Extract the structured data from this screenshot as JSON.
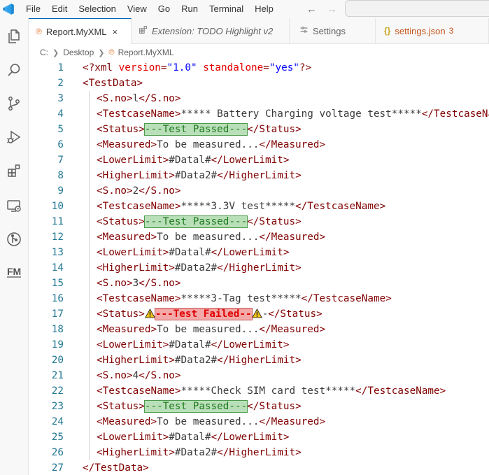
{
  "menu": {
    "items": [
      "File",
      "Edit",
      "Selection",
      "View",
      "Go",
      "Run",
      "Terminal",
      "Help"
    ]
  },
  "tabs": [
    {
      "label": "Report.MyXML",
      "icon": "rss-file-icon",
      "active": true,
      "has_close": true,
      "close_glyph": "×"
    },
    {
      "label": "Extension: TODO Highlight v2",
      "icon": "extension-preview-icon",
      "active": false,
      "italic": true
    },
    {
      "label": "Settings",
      "icon": "settings-sliders-icon",
      "active": false
    },
    {
      "label": "settings.json",
      "icon": "json-braces-icon",
      "active": false,
      "modified": true,
      "problem_count": "3"
    }
  ],
  "breadcrumb": {
    "items": [
      "C:",
      "Desktop",
      "Report.MyXML"
    ]
  },
  "editor": {
    "lines": [
      {
        "n": "1",
        "indent": 0,
        "parts": [
          [
            "tag",
            "<?xml "
          ],
          [
            "attr",
            "version"
          ],
          [
            "tag",
            "="
          ],
          [
            "val",
            "\"1.0\""
          ],
          [
            "tag",
            " "
          ],
          [
            "attr",
            "standalone"
          ],
          [
            "tag",
            "="
          ],
          [
            "val",
            "\"yes\""
          ],
          [
            "tag",
            "?>"
          ]
        ]
      },
      {
        "n": "2",
        "indent": 0,
        "parts": [
          [
            "tag",
            "<TestData>"
          ]
        ]
      },
      {
        "n": "3",
        "indent": 1,
        "parts": [
          [
            "tag",
            "<S.no>"
          ],
          [
            "txt",
            "l"
          ],
          [
            "tag",
            "</S.no>"
          ]
        ]
      },
      {
        "n": "4",
        "indent": 1,
        "parts": [
          [
            "tag",
            "<TestcaseName>"
          ],
          [
            "txt",
            "***** Battery Charging voltage test*****"
          ],
          [
            "tag",
            "</TestcaseName>"
          ]
        ]
      },
      {
        "n": "5",
        "indent": 1,
        "parts": [
          [
            "tag",
            "<Status>"
          ],
          [
            "pass",
            "---Test Passed---"
          ],
          [
            "tag",
            "</Status>"
          ]
        ]
      },
      {
        "n": "6",
        "indent": 1,
        "parts": [
          [
            "tag",
            "<Measured>"
          ],
          [
            "txt",
            "To be measured..."
          ],
          [
            "tag",
            "</Measured>"
          ]
        ]
      },
      {
        "n": "7",
        "indent": 1,
        "parts": [
          [
            "tag",
            "<LowerLimit>"
          ],
          [
            "txt",
            "#Datal#"
          ],
          [
            "tag",
            "</LowerLimit>"
          ]
        ]
      },
      {
        "n": "8",
        "indent": 1,
        "parts": [
          [
            "tag",
            "<HigherLimit>"
          ],
          [
            "txt",
            "#Data2#"
          ],
          [
            "tag",
            "</HigherLimit>"
          ]
        ]
      },
      {
        "n": "9",
        "indent": 1,
        "parts": [
          [
            "tag",
            "<S.no>"
          ],
          [
            "txt",
            "2"
          ],
          [
            "tag",
            "</S.no>"
          ]
        ]
      },
      {
        "n": "10",
        "indent": 1,
        "parts": [
          [
            "tag",
            "<TestcaseName>"
          ],
          [
            "txt",
            "*****3.3V test*****"
          ],
          [
            "tag",
            "</TestcaseName>"
          ]
        ]
      },
      {
        "n": "11",
        "indent": 1,
        "parts": [
          [
            "tag",
            "<Status>"
          ],
          [
            "pass",
            "---Test Passed---"
          ],
          [
            "tag",
            "</Status>"
          ]
        ]
      },
      {
        "n": "12",
        "indent": 1,
        "parts": [
          [
            "tag",
            "<Measured>"
          ],
          [
            "txt",
            "To be measured..."
          ],
          [
            "tag",
            "</Measured>"
          ]
        ]
      },
      {
        "n": "13",
        "indent": 1,
        "parts": [
          [
            "tag",
            "<LowerLimit>"
          ],
          [
            "txt",
            "#Datal#"
          ],
          [
            "tag",
            "</LowerLimit>"
          ]
        ]
      },
      {
        "n": "14",
        "indent": 1,
        "parts": [
          [
            "tag",
            "<HigherLimit>"
          ],
          [
            "txt",
            "#Data2#"
          ],
          [
            "tag",
            "</HigherLimit>"
          ]
        ]
      },
      {
        "n": "15",
        "indent": 1,
        "parts": [
          [
            "tag",
            "<S.no>"
          ],
          [
            "txt",
            "3"
          ],
          [
            "tag",
            "</S.no>"
          ]
        ]
      },
      {
        "n": "16",
        "indent": 1,
        "parts": [
          [
            "tag",
            "<TestcaseName>"
          ],
          [
            "txt",
            "*****3-Tag test*****"
          ],
          [
            "tag",
            "</TestcaseName>"
          ]
        ]
      },
      {
        "n": "17",
        "indent": 1,
        "parts": [
          [
            "tag",
            "<Status>"
          ],
          [
            "warn",
            "warning-icon"
          ],
          [
            "fail",
            "---Test Failed--"
          ],
          [
            "warn",
            "warning-icon"
          ],
          [
            "txt",
            "-"
          ],
          [
            "tag",
            "</Status>"
          ]
        ]
      },
      {
        "n": "18",
        "indent": 1,
        "parts": [
          [
            "tag",
            "<Measured>"
          ],
          [
            "txt",
            "To be measured..."
          ],
          [
            "tag",
            "</Measured>"
          ]
        ]
      },
      {
        "n": "19",
        "indent": 1,
        "parts": [
          [
            "tag",
            "<LowerLimit>"
          ],
          [
            "txt",
            "#Datal#"
          ],
          [
            "tag",
            "</LowerLimit>"
          ]
        ]
      },
      {
        "n": "20",
        "indent": 1,
        "parts": [
          [
            "tag",
            "<HigherLimit>"
          ],
          [
            "txt",
            "#Data2#"
          ],
          [
            "tag",
            "</HigherLimit>"
          ]
        ]
      },
      {
        "n": "21",
        "indent": 1,
        "parts": [
          [
            "tag",
            "<S.no>"
          ],
          [
            "txt",
            "4"
          ],
          [
            "tag",
            "</S.no>"
          ]
        ]
      },
      {
        "n": "22",
        "indent": 1,
        "parts": [
          [
            "tag",
            "<TestcaseName>"
          ],
          [
            "txt",
            "*****Check SIM card test*****"
          ],
          [
            "tag",
            "</TestcaseName>"
          ]
        ]
      },
      {
        "n": "23",
        "indent": 1,
        "parts": [
          [
            "tag",
            "<Status>"
          ],
          [
            "pass",
            "---Test Passed---"
          ],
          [
            "tag",
            "</Status>"
          ]
        ]
      },
      {
        "n": "24",
        "indent": 1,
        "parts": [
          [
            "tag",
            "<Measured>"
          ],
          [
            "txt",
            "To be measured..."
          ],
          [
            "tag",
            "</Measured>"
          ]
        ]
      },
      {
        "n": "25",
        "indent": 1,
        "parts": [
          [
            "tag",
            "<LowerLimit>"
          ],
          [
            "txt",
            "#Datal#"
          ],
          [
            "tag",
            "</LowerLimit>"
          ]
        ]
      },
      {
        "n": "26",
        "indent": 1,
        "parts": [
          [
            "tag",
            "<HigherLimit>"
          ],
          [
            "txt",
            "#Data2#"
          ],
          [
            "tag",
            "</HigherLimit>"
          ]
        ]
      },
      {
        "n": "27",
        "indent": 0,
        "parts": [
          [
            "tag",
            "</TestData>"
          ]
        ]
      }
    ]
  },
  "colors": {
    "accent": "#005fb8",
    "tag": "#800000",
    "line_number": "#237893",
    "pass_bg": "#b9dfb9",
    "fail_bg": "#f4a9a9",
    "modified": "#c4551a"
  }
}
